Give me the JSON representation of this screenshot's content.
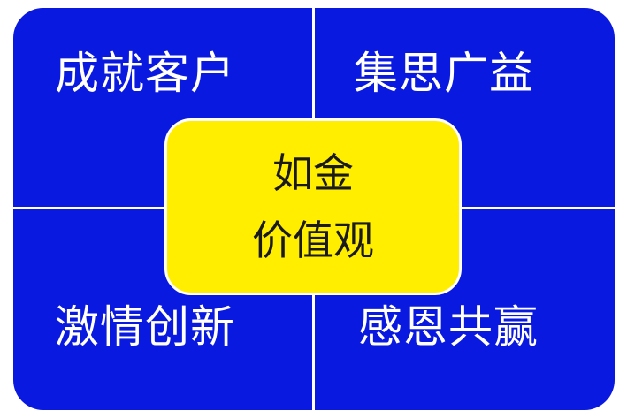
{
  "quadrants": {
    "top_left": "成就客户",
    "top_right": "集思广益",
    "bottom_left": "激情创新",
    "bottom_right": "感恩共赢"
  },
  "center": {
    "line1": "如金",
    "line2": "价值观"
  },
  "colors": {
    "panel_blue": "#0a19e0",
    "center_yellow": "#ffee00",
    "divider": "#ffffff"
  }
}
